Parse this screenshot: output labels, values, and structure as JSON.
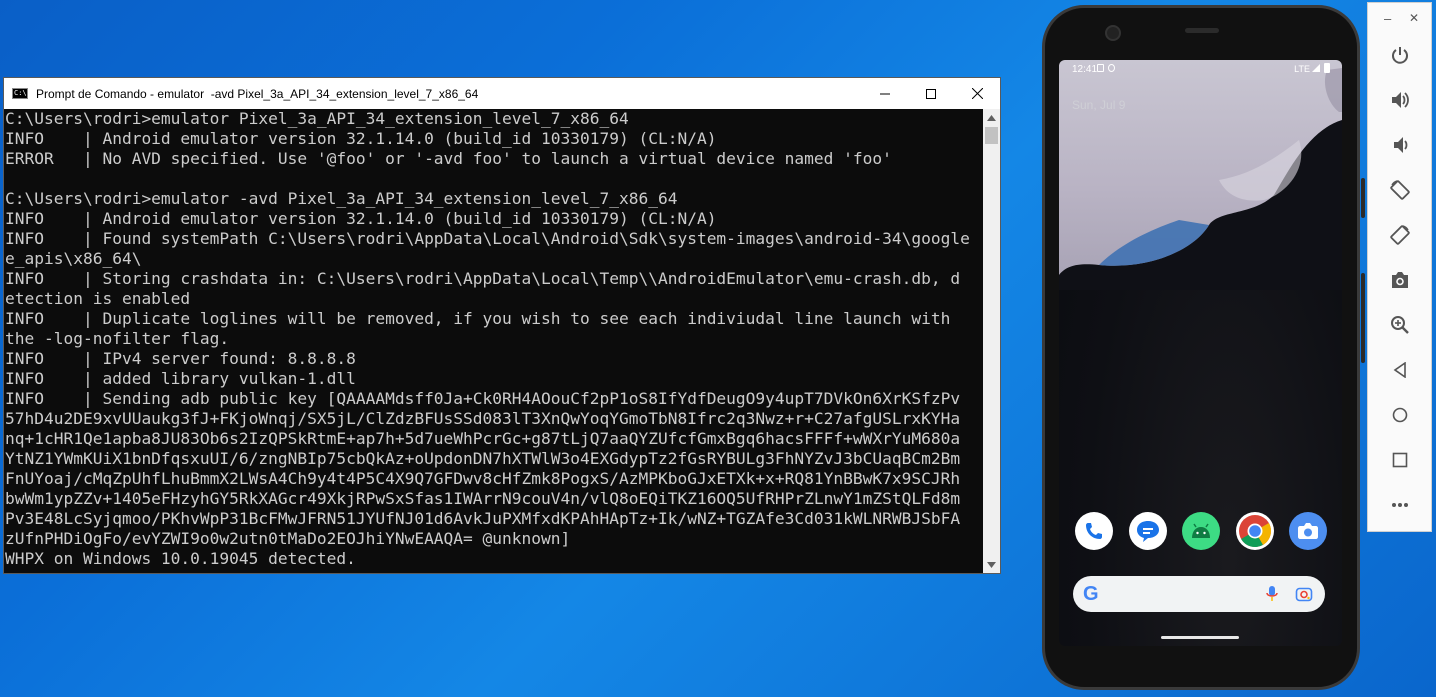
{
  "cmd": {
    "title": "Prompt de Comando - emulator  -avd Pixel_3a_API_34_extension_level_7_x86_64",
    "icon": "cmd-icon",
    "icon_text": "C:\\",
    "lines": [
      "C:\\Users\\rodri>emulator Pixel_3a_API_34_extension_level_7_x86_64",
      "INFO    | Android emulator version 32.1.14.0 (build_id 10330179) (CL:N/A)",
      "ERROR   | No AVD specified. Use '@foo' or '-avd foo' to launch a virtual device named 'foo'",
      "",
      "C:\\Users\\rodri>emulator -avd Pixel_3a_API_34_extension_level_7_x86_64",
      "INFO    | Android emulator version 32.1.14.0 (build_id 10330179) (CL:N/A)",
      "INFO    | Found systemPath C:\\Users\\rodri\\AppData\\Local\\Android\\Sdk\\system-images\\android-34\\google",
      "e_apis\\x86_64\\",
      "INFO    | Storing crashdata in: C:\\Users\\rodri\\AppData\\Local\\Temp\\\\AndroidEmulator\\emu-crash.db, d",
      "etection is enabled",
      "INFO    | Duplicate loglines will be removed, if you wish to see each indiviudal line launch with",
      "the -log-nofilter flag.",
      "INFO    | IPv4 server found: 8.8.8.8",
      "INFO    | added library vulkan-1.dll",
      "INFO    | Sending adb public key [QAAAAMdsff0Ja+Ck0RH4AOouCf2pP1oS8IfYdfDeugO9y4upT7DVkOn6XrKSfzPv",
      "57hD4u2DE9xvUUaukg3fJ+FKjoWnqj/SX5jL/ClZdzBFUsSSd083lT3XnQwYoqYGmoTbN8Ifrc2q3Nwz+r+C27afgUSLrxKYHa",
      "nq+1cHR1Qe1apba8JU83Ob6s2IzQPSkRtmE+ap7h+5d7ueWhPcrGc+g87tLjQ7aaQYZUfcfGmxBgq6hacsFFFf+wWXrYuM680a",
      "YtNZ1YWmKUiX1bnDfqsxuUI/6/zngNBIp75cbQkAz+oUpdonDN7hXTWlW3o4EXGdypTz2fGsRYBULg3FhNYZvJ3bCUaqBCm2Bm",
      "FnUYoaj/cMqZpUhfLhuBmmX2LWsA4Ch9y4t4P5C4X9Q7GFDwv8cHfZmk8PogxS/AzMPKboGJxETXk+x+RQ81YnBBwK7x9SCJRh",
      "bwWm1ypZZv+1405eFHzyhGY5RkXAGcr49XkjRPwSxSfas1IWArrN9couV4n/vlQ8oEQiTKZ16OQ5UfRHPrZLnwY1mZStQLFd8m",
      "Pv3E48LcSyjqmoo/PKhvWpP31BcFMwJFRN51JYUfNJ01d6AvkJuPXMfxdKPAhHApTz+Ik/wNZ+TGZAfe3Cd031kWLNRWBJSbFA",
      "zUfnPHDiOgFo/evYZWI9o0w2utn0tMaDo2EOJhiYNwEAAQA= @unknown]",
      "WHPX on Windows 10.0.19045 detected."
    ]
  },
  "phone": {
    "status_time": "12:41",
    "status_network": "LTE",
    "date": "Sun, Jul 9",
    "dock_apps": [
      "phone-app-icon",
      "messages-app-icon",
      "android-app-icon",
      "chrome-app-icon",
      "camera-app-icon"
    ],
    "search_logo": "G",
    "search_icons": [
      "mic-icon",
      "lens-icon"
    ]
  },
  "emulator_toolbar": {
    "minimize": "–",
    "close": "✕",
    "items": [
      "power-icon",
      "volume-up-icon",
      "volume-down-icon",
      "rotate-left-icon",
      "rotate-right-icon",
      "screenshot-icon",
      "zoom-icon",
      "back-icon",
      "home-icon",
      "overview-icon",
      "more-icon"
    ]
  },
  "colors": {
    "desktop": "#0b6fd8",
    "terminal_bg": "#0c0c0c",
    "terminal_fg": "#cccccc"
  }
}
